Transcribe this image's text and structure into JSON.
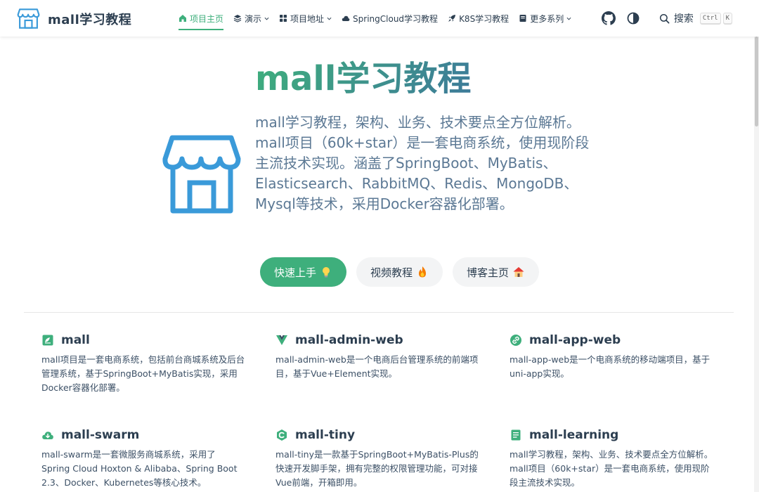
{
  "brand": {
    "title": "mall学习教程",
    "logo_icon": "store-icon"
  },
  "nav": {
    "items": [
      {
        "label": "项目主页",
        "icon": "home-icon",
        "active": true,
        "dropdown": false
      },
      {
        "label": "演示",
        "icon": "layers-icon",
        "active": false,
        "dropdown": true
      },
      {
        "label": "项目地址",
        "icon": "grid-icon",
        "active": false,
        "dropdown": true
      },
      {
        "label": "SpringCloud学习教程",
        "icon": "cloud-icon",
        "active": false,
        "dropdown": false
      },
      {
        "label": "K8S学习教程",
        "icon": "rocket-icon",
        "active": false,
        "dropdown": false
      },
      {
        "label": "更多系列",
        "icon": "book-icon",
        "active": false,
        "dropdown": true
      }
    ]
  },
  "tools": {
    "github_icon": "github-icon",
    "theme_icon": "theme-toggle-icon",
    "search_label": "搜索",
    "kbd_ctrl": "Ctrl",
    "kbd_k": "K"
  },
  "hero": {
    "title": "mall学习教程",
    "description": "mall学习教程，架构、业务、技术要点全方位解析。mall项目（60k+star）是一套电商系统，使用现阶段主流技术实现。涵盖了SpringBoot、MyBatis、Elasticsearch、RabbitMQ、Redis、MongoDB、Mysql等技术，采用Docker容器化部署。",
    "actions": [
      {
        "label": "快速上手",
        "emoji": "lightbulb-icon",
        "primary": true
      },
      {
        "label": "视频教程",
        "emoji": "fire-icon",
        "primary": false
      },
      {
        "label": "博客主页",
        "emoji": "house-icon",
        "primary": false
      }
    ]
  },
  "features": [
    {
      "title": "mall",
      "icon": "leaf-book-icon",
      "desc": "mall项目是一套电商系统，包括前台商城系统及后台管理系统，基于SpringBoot+MyBatis实现，采用Docker容器化部署。"
    },
    {
      "title": "mall-admin-web",
      "icon": "vue-icon",
      "desc": "mall-admin-web是一个电商后台管理系统的前端项目，基于Vue+Element实现。"
    },
    {
      "title": "mall-app-web",
      "icon": "link-icon",
      "desc": "mall-app-web是一个电商系统的移动端项目，基于uni-app实现。"
    },
    {
      "title": "mall-swarm",
      "icon": "cloud-download-icon",
      "desc": "mall-swarm是一套微服务商城系统，采用了 Spring Cloud Hoxton & Alibaba、Spring Boot 2.3、Docker、Kubernetes等核心技术。"
    },
    {
      "title": "mall-tiny",
      "icon": "hexagon-c-icon",
      "desc": "mall-tiny是一款基于SpringBoot+MyBatis-Plus的快速开发脚手架，拥有完整的权限管理功能，可对接Vue前端，开箱即用。"
    },
    {
      "title": "mall-learning",
      "icon": "document-icon",
      "desc": "mall学习教程，架构、业务、技术要点全方位解析。mall项目（60k+star）是一套电商系统，使用现阶段主流技术实现。"
    }
  ],
  "colors": {
    "accent": "#3eaf7c",
    "text": "#2c3e50",
    "logo_blue": "#3a9ad9"
  }
}
